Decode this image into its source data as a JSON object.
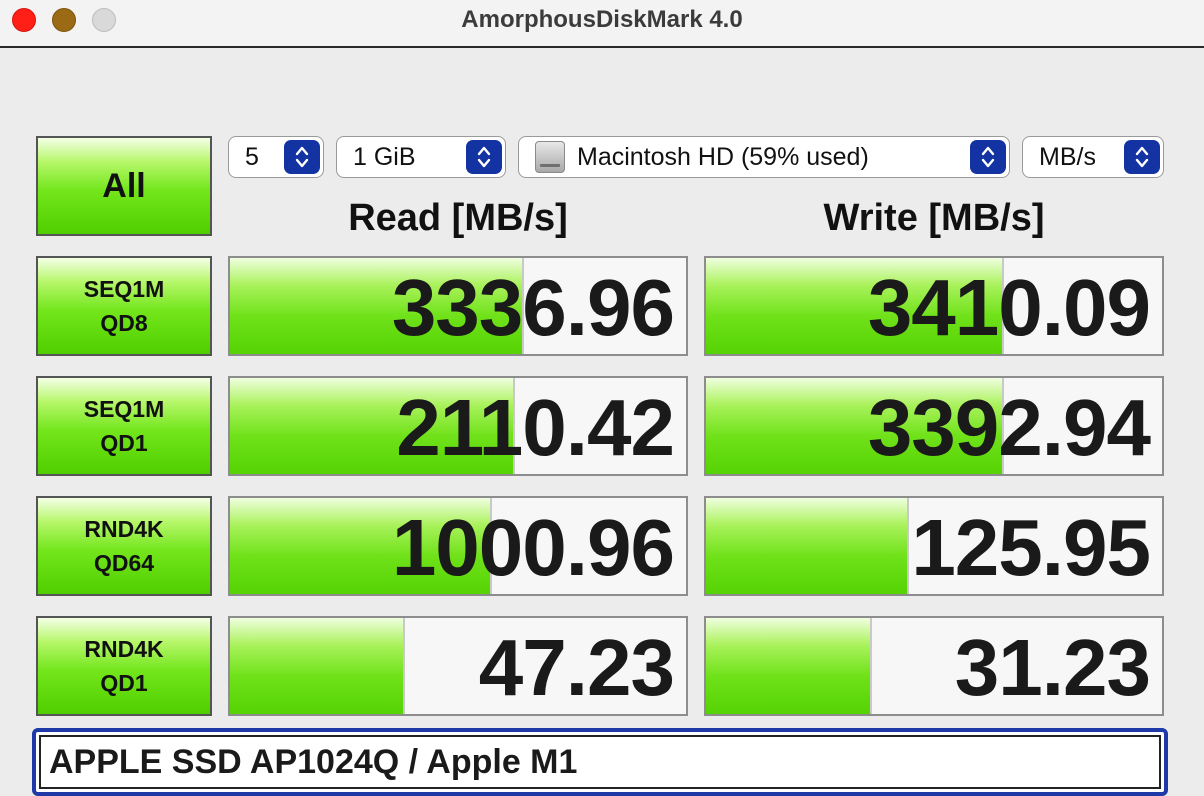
{
  "window": {
    "title": "AmorphousDiskMark 4.0"
  },
  "controls": {
    "all_label": "All",
    "count": "5",
    "size": "1 GiB",
    "target": "Macintosh HD (59% used)",
    "unit": "MB/s"
  },
  "headers": {
    "read": "Read [MB/s]",
    "write": "Write [MB/s]"
  },
  "rows": [
    {
      "line1": "SEQ1M",
      "line2": "QD8",
      "read": "3336.96",
      "write": "3410.09",
      "read_fill": 0.64,
      "write_fill": 0.65
    },
    {
      "line1": "SEQ1M",
      "line2": "QD1",
      "read": "2110.42",
      "write": "3392.94",
      "read_fill": 0.62,
      "write_fill": 0.65
    },
    {
      "line1": "RND4K",
      "line2": "QD64",
      "read": "1000.96",
      "write": "125.95",
      "read_fill": 0.57,
      "write_fill": 0.44
    },
    {
      "line1": "RND4K",
      "line2": "QD1",
      "read": "47.23",
      "write": "31.23",
      "read_fill": 0.38,
      "write_fill": 0.36
    }
  ],
  "device": {
    "value": "APPLE SSD AP1024Q / Apple M1"
  },
  "colors": {
    "accent": "#1433a3",
    "bar_green": "#70e21a",
    "close": "#ff1f17",
    "minimize": "#9c6a14",
    "zoom": "#d9d9d9"
  }
}
